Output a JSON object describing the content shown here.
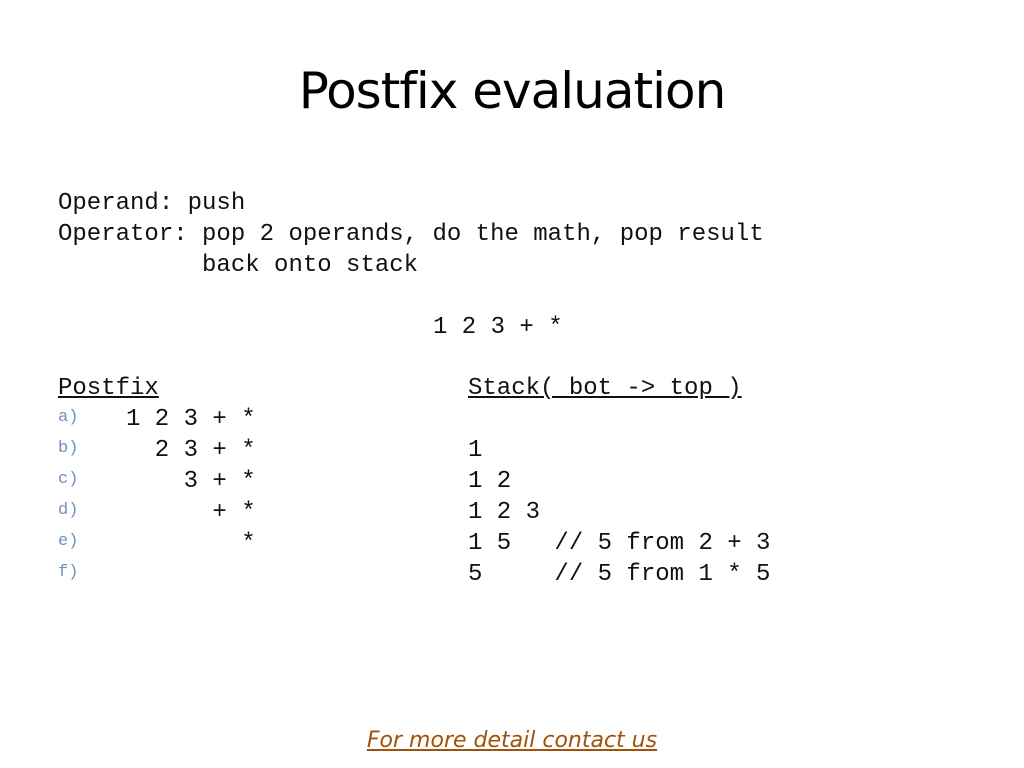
{
  "title": "Postfix  evaluation",
  "rules": {
    "line1": "Operand: push",
    "line2": "Operator: pop 2 operands, do the math, pop result",
    "line3": "          back onto stack"
  },
  "expression": "1 2 3 + *",
  "headers": {
    "postfix": "Postfix",
    "stack": "Stack( bot -> top )"
  },
  "rows": [
    {
      "label": "a)",
      "postfix": "1 2 3 + *",
      "stack": ""
    },
    {
      "label": "b)",
      "postfix": "  2 3 + *",
      "stack": "1"
    },
    {
      "label": "c)",
      "postfix": "    3 + *",
      "stack": "1 2"
    },
    {
      "label": "d)",
      "postfix": "      + *",
      "stack": "1 2 3"
    },
    {
      "label": "e)",
      "postfix": "        *",
      "stack": "1 5   // 5 from 2 + 3"
    },
    {
      "label": "f)",
      "postfix": "",
      "stack": "5     // 5 from 1 * 5"
    }
  ],
  "footer": "For more detail contact us"
}
